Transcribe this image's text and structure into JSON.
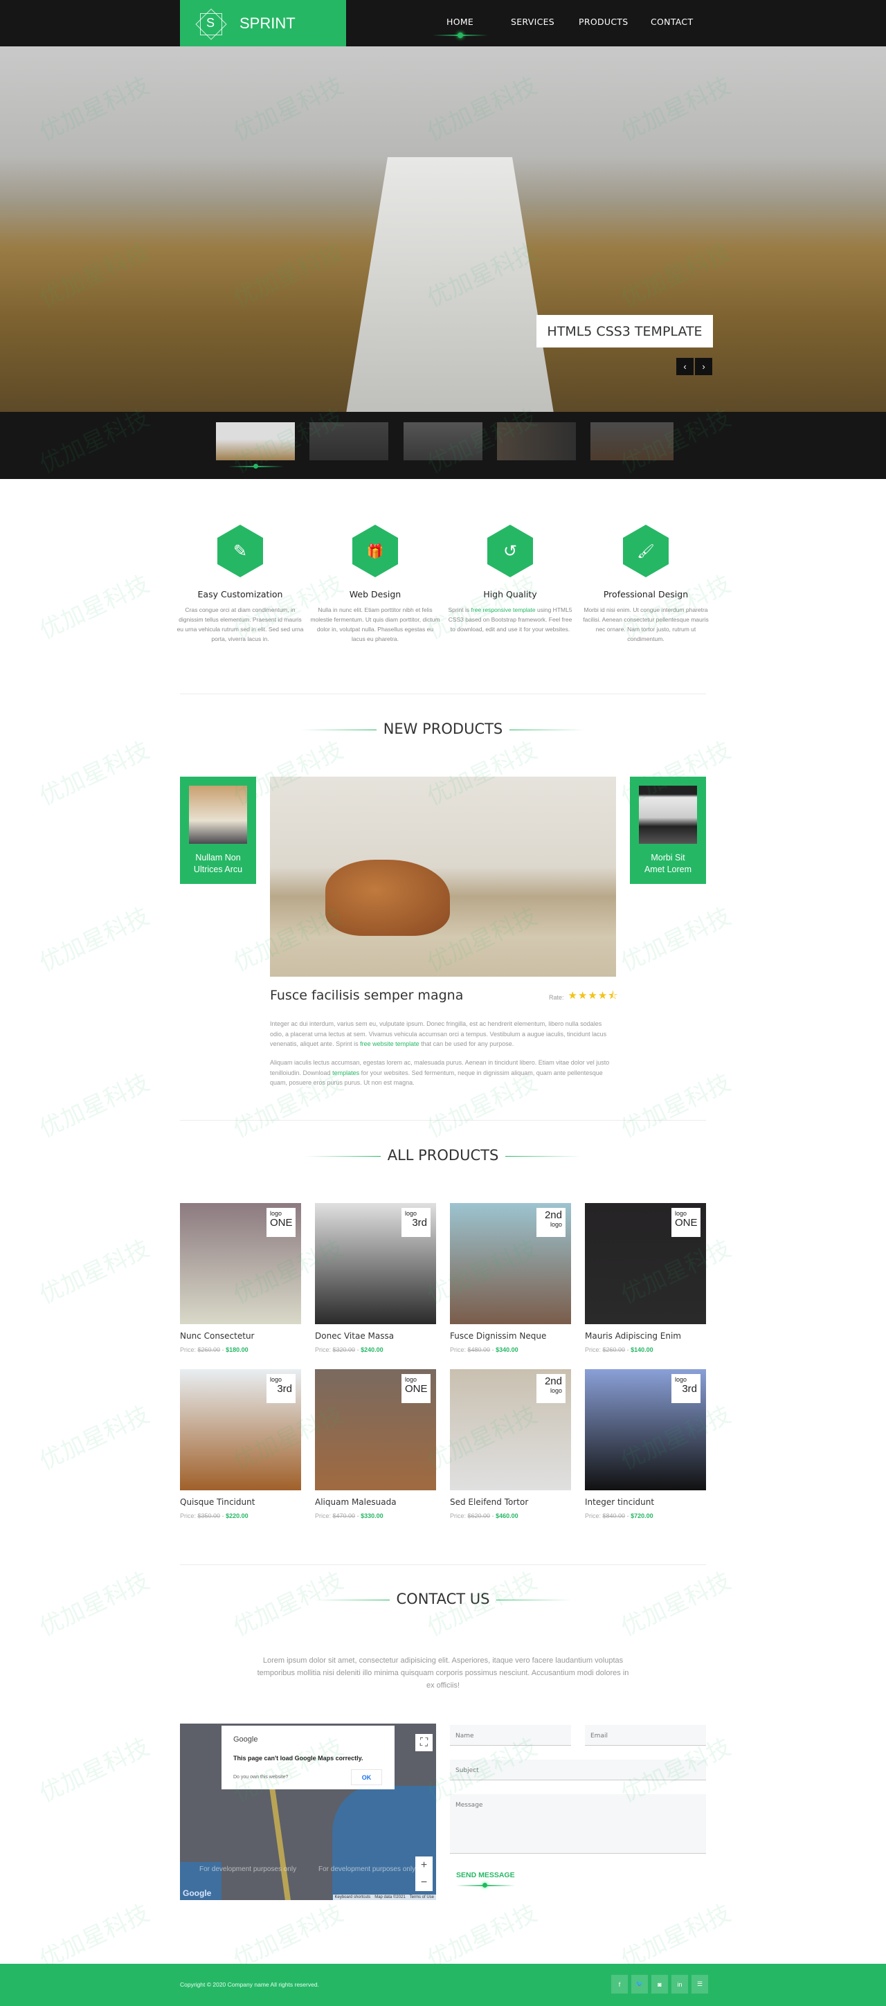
{
  "brand": {
    "logo_letter": "S",
    "name": "SPRINT",
    "accent": "#26b765"
  },
  "nav": [
    {
      "label": "HOME",
      "active": true
    },
    {
      "label": "SERVICES"
    },
    {
      "label": "PRODUCTS"
    },
    {
      "label": "CONTACT"
    }
  ],
  "hero": {
    "caption": "HTML5 CSS3 TEMPLATE",
    "prev_icon": "‹",
    "next_icon": "›",
    "thumbs_count": 5,
    "active_thumb": 0
  },
  "features": [
    {
      "icon": "pencil-icon",
      "glyph": "✎",
      "title": "Easy Customization",
      "text": "Cras congue orci at diam condimentum, in dignissim tellus elementum. Praesent id mauris eu urna vehicula rutrum sed in elit. Sed sed urna porta, viverra lacus in."
    },
    {
      "icon": "gift-icon",
      "glyph": "🎁",
      "title": "Web Design",
      "text": "Nulla in nunc elit. Etiam porttitor nibh et felis molestie fermentum. Ut quis diam porttitor, dictum dolor in, volutpat nulla. Phasellus egestas eu lacus eu pharetra."
    },
    {
      "icon": "history-icon",
      "glyph": "↺",
      "title": "High Quality",
      "text_before": "Sprint is ",
      "link": "free responsive template",
      "text_after": " using HTML5 CSS3 based on Bootstrap framework. Feel free to download, edit and use it for your websites."
    },
    {
      "icon": "paint-roller-icon",
      "glyph": "🖌",
      "title": "Professional Design",
      "text": "Morbi id nisi enim. Ut congue interdum pharetra facilisi. Aenean consectetur pellentesque mauris nec ornare. Nam tortor justo, rutrum ut condimentum."
    }
  ],
  "new_products": {
    "heading": "NEW PRODUCTS",
    "prev": {
      "title_line1": "Nullam Non",
      "title_line2": "Ultrices Arcu"
    },
    "next": {
      "title_line1": "Morbi Sit",
      "title_line2": "Amet Lorem"
    },
    "title": "Fusce facilisis semper magna",
    "rate_label": "Rate:",
    "rating": 4.5,
    "rating_stars": "★★★★⯪",
    "para1_before": "Integer ac dui interdum, varius sem eu, vulputate ipsum. Donec fringilla, est ac hendrerit elementum, libero nulla sodales odio, a placerat urna lectus at sem. Vivamus vehicula accumsan orci a tempus. Vestibulum a augue iaculis, tincidunt lacus venenatis, aliquet ante. Sprint is ",
    "para1_link": "free website template",
    "para1_after": " that can be used for any purpose.",
    "para2_before": "Aliquam iaculis lectus accumsan, egestas lorem ac, malesuada purus. Aenean in tincidunt libero. Etiam vitae dolor vel justo tenilloiudin. Download ",
    "para2_link": "templates",
    "para2_after": " for your websites. Sed fermentum, neque in dignissim aliquam, quam ante pellentesque quam, posuere eros purus purus. Ut non est magna."
  },
  "all_products": {
    "heading": "ALL PRODUCTS",
    "price_label": "Price:",
    "items": [
      {
        "name": "Nunc Consectetur",
        "old": "$260.00",
        "new": "$180.00",
        "badge_top": "logo",
        "badge_main": "ONE",
        "color": "#8c7a80,#d9d9c8"
      },
      {
        "name": "Donec Vitae Massa",
        "old": "$320.00",
        "new": "$240.00",
        "badge_top": "logo",
        "badge_main": "3rd",
        "color": "#e0e0e0,#2a2a2a"
      },
      {
        "name": "Fusce Dignissim Neque",
        "old": "$480.00",
        "new": "$340.00",
        "badge_top": "2nd",
        "badge_main": "logo",
        "color": "#9cc4d0,#7a5c4a"
      },
      {
        "name": "Mauris Adipiscing Enim",
        "old": "$260.00",
        "new": "$140.00",
        "badge_top": "logo",
        "badge_main": "ONE",
        "color": "#252325,#2a2a2a"
      },
      {
        "name": "Quisque Tincidunt",
        "old": "$350.00",
        "new": "$220.00",
        "badge_top": "logo",
        "badge_main": "3rd",
        "color": "#e8eef2,#a0602a"
      },
      {
        "name": "Aliquam Malesuada",
        "old": "$470.00",
        "new": "$330.00",
        "badge_top": "logo",
        "badge_main": "ONE",
        "color": "#7a6a60,#a06a40"
      },
      {
        "name": "Sed Eleifend Tortor",
        "old": "$620.00",
        "new": "$460.00",
        "badge_top": "2nd",
        "badge_main": "logo",
        "color": "#c9c0b0,#e0e0e0"
      },
      {
        "name": "Integer tincidunt",
        "old": "$840.00",
        "new": "$720.00",
        "badge_top": "logo",
        "badge_main": "3rd",
        "color": "#8aa0d8,#111"
      }
    ]
  },
  "contact": {
    "heading": "CONTACT US",
    "text": "Lorem ipsum dolor sit amet, consectetur adipisicing elit. Asperiores, itaque vero facere laudantium voluptas temporibus mollitia nisi deleniti illo minima quisquam corporis possimus nesciunt. Accusantium modi dolores in ex officiis!",
    "map": {
      "dialog_brand": "Google",
      "dialog_message": "This page can't load Google Maps correctly.",
      "dialog_question": "Do you own this website?",
      "dialog_ok": "OK",
      "dev_notice": "For development purposes only",
      "footer": [
        "Keyboard shortcuts",
        "Map data ©2021",
        "Terms of Use"
      ],
      "logo": "Google"
    },
    "placeholders": {
      "name": "Name",
      "email": "Email",
      "subject": "Subject",
      "message": "Message"
    },
    "send": "SEND MESSAGE"
  },
  "footer": {
    "copyright": "Copyright © 2020 Company name All rights reserved.",
    "social": [
      {
        "icon": "facebook-icon",
        "glyph": "f"
      },
      {
        "icon": "twitter-icon",
        "glyph": "🐦"
      },
      {
        "icon": "instagram-icon",
        "glyph": "◙"
      },
      {
        "icon": "linkedin-icon",
        "glyph": "in"
      },
      {
        "icon": "rss-icon",
        "glyph": "☰"
      }
    ]
  },
  "watermark": "优加星科技"
}
